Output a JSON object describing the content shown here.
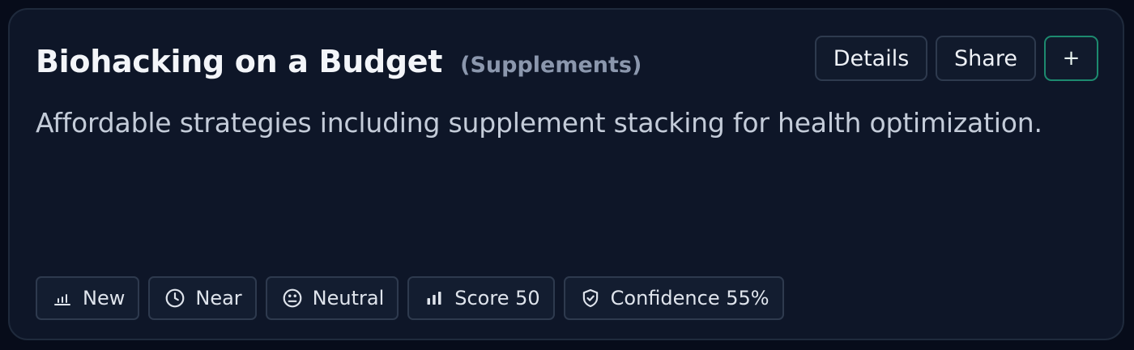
{
  "card": {
    "title": "Biohacking on a Budget",
    "category": "(Supplements)",
    "description": "Affordable strategies including supplement stacking for health optimization."
  },
  "actions": {
    "details_label": "Details",
    "share_label": "Share",
    "add_label": "+"
  },
  "tags": [
    {
      "label": "New",
      "icon": "bar-chart-low-icon"
    },
    {
      "label": "Near",
      "icon": "clock-icon"
    },
    {
      "label": "Neutral",
      "icon": "neutral-face-icon"
    },
    {
      "label": "Score 50",
      "icon": "bar-chart-icon"
    },
    {
      "label": "Confidence 55%",
      "icon": "shield-check-icon"
    }
  ],
  "colors": {
    "background": "#070c1a",
    "card": "#0e1628",
    "accent_border": "#1d8a6f"
  }
}
